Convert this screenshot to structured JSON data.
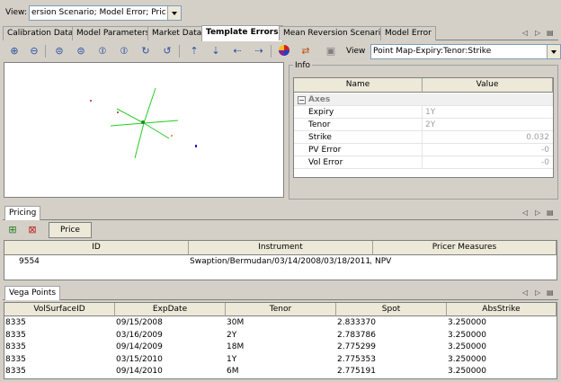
{
  "viewbar": {
    "label": "View:",
    "selected": "ersion Scenario; Model Error; Pricing"
  },
  "tabs": [
    {
      "label": "Calibration Data"
    },
    {
      "label": "Model Parameters"
    },
    {
      "label": "Market Data"
    },
    {
      "label": "Template Errors"
    },
    {
      "label": "Mean Reversion Scenario"
    },
    {
      "label": "Model Error"
    }
  ],
  "toolbar": {
    "view_label": "View",
    "view_selected": "Point Map-Expiry:Tenor:Strike"
  },
  "info": {
    "title": "Info",
    "col_name": "Name",
    "col_value": "Value",
    "group": "Axes",
    "rows": [
      {
        "name": "Expiry",
        "value": "1Y"
      },
      {
        "name": "Tenor",
        "value": "2Y"
      },
      {
        "name": "Strike",
        "value": "0.032"
      },
      {
        "name": "PV Error",
        "value": "-0"
      },
      {
        "name": "Vol Error",
        "value": "-0"
      }
    ]
  },
  "pricing": {
    "tab": "Pricing",
    "price_button": "Price",
    "columns": [
      "ID",
      "Instrument",
      "Pricer Measures"
    ],
    "row": {
      "id": "9554",
      "instrument": "Swaption/Bermudan/03/14/2008/03/18/2011/P...",
      "measures": "NPV"
    }
  },
  "vega": {
    "tab": "Vega Points",
    "columns": [
      "VolSurfaceID",
      "ExpDate",
      "Tenor",
      "Spot",
      "AbsStrike"
    ],
    "rows": [
      [
        "8335",
        "09/15/2008",
        "30M",
        "2.833370",
        "3.250000"
      ],
      [
        "8335",
        "03/16/2009",
        "2Y",
        "2.783786",
        "3.250000"
      ],
      [
        "8335",
        "09/14/2009",
        "18M",
        "2.775299",
        "3.250000"
      ],
      [
        "8335",
        "03/15/2010",
        "1Y",
        "2.775353",
        "3.250000"
      ],
      [
        "8335",
        "09/14/2010",
        "6M",
        "2.775191",
        "3.250000"
      ]
    ]
  },
  "colors": {
    "accent_green": "#22cc22",
    "panel": "#d4d0c8"
  }
}
